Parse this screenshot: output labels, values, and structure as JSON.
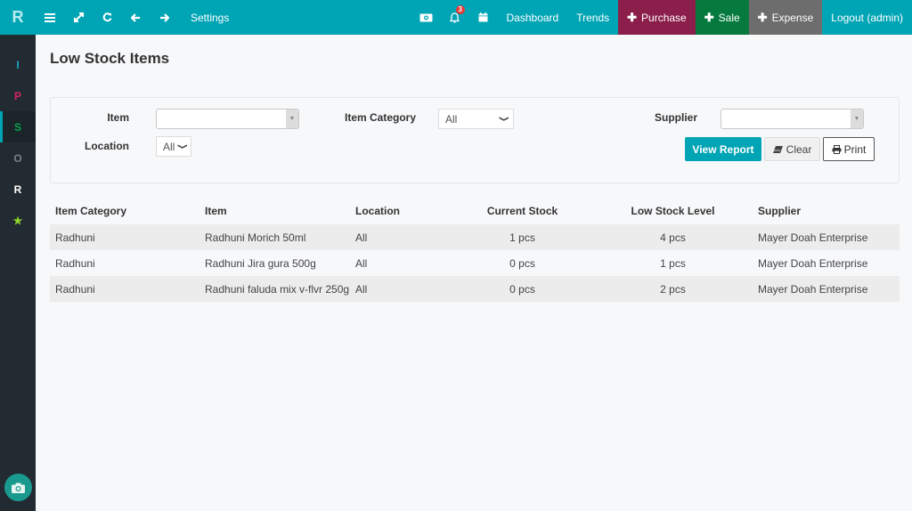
{
  "topbar": {
    "logo": "R",
    "icons": [
      "menu-icon",
      "expand-icon",
      "refresh-icon",
      "arrow-left-icon",
      "arrow-right-icon"
    ],
    "settings_label": "Settings",
    "notification_count": "3",
    "dashboard_label": "Dashboard",
    "trends_label": "Trends",
    "purchase_label": "Purchase",
    "sale_label": "Sale",
    "expense_label": "Expense",
    "logout_label": "Logout (admin)",
    "colors": {
      "bar": "#00a5b5",
      "purchase": "#8b1e4a",
      "sale": "#067a3e",
      "expense": "#6d6d6d"
    }
  },
  "sidebar": {
    "items": [
      {
        "label": "I",
        "color": "#1fa2c0"
      },
      {
        "label": "P",
        "color": "#d6245e"
      },
      {
        "label": "S",
        "color": "#0aa34f",
        "active": true
      },
      {
        "label": "O",
        "color": "#7a8086"
      },
      {
        "label": "R",
        "color": "#ffffff"
      },
      {
        "label": "★",
        "color": "#8fd42a"
      }
    ]
  },
  "page": {
    "title": "Low Stock Items"
  },
  "filters": {
    "item_label": "Item",
    "item_value": "",
    "item_category_label": "Item Category",
    "item_category_value": "All",
    "supplier_label": "Supplier",
    "supplier_value": "",
    "location_label": "Location",
    "location_value": "All",
    "view_report_label": "View Report",
    "clear_label": "Clear",
    "print_label": "Print"
  },
  "table": {
    "headers": [
      "Item Category",
      "Item",
      "Location",
      "Current Stock",
      "Low Stock Level",
      "Supplier"
    ],
    "rows": [
      [
        "Radhuni",
        "Radhuni Morich 50ml",
        "All",
        "1 pcs",
        "4 pcs",
        "Mayer Doah Enterprise"
      ],
      [
        "Radhuni",
        "Radhuni Jira gura 500g",
        "All",
        "0 pcs",
        "1 pcs",
        "Mayer Doah Enterprise"
      ],
      [
        "Radhuni",
        "Radhuni faluda mix v-flvr 250g",
        "All",
        "0 pcs",
        "2 pcs",
        "Mayer Doah Enterprise"
      ]
    ]
  }
}
